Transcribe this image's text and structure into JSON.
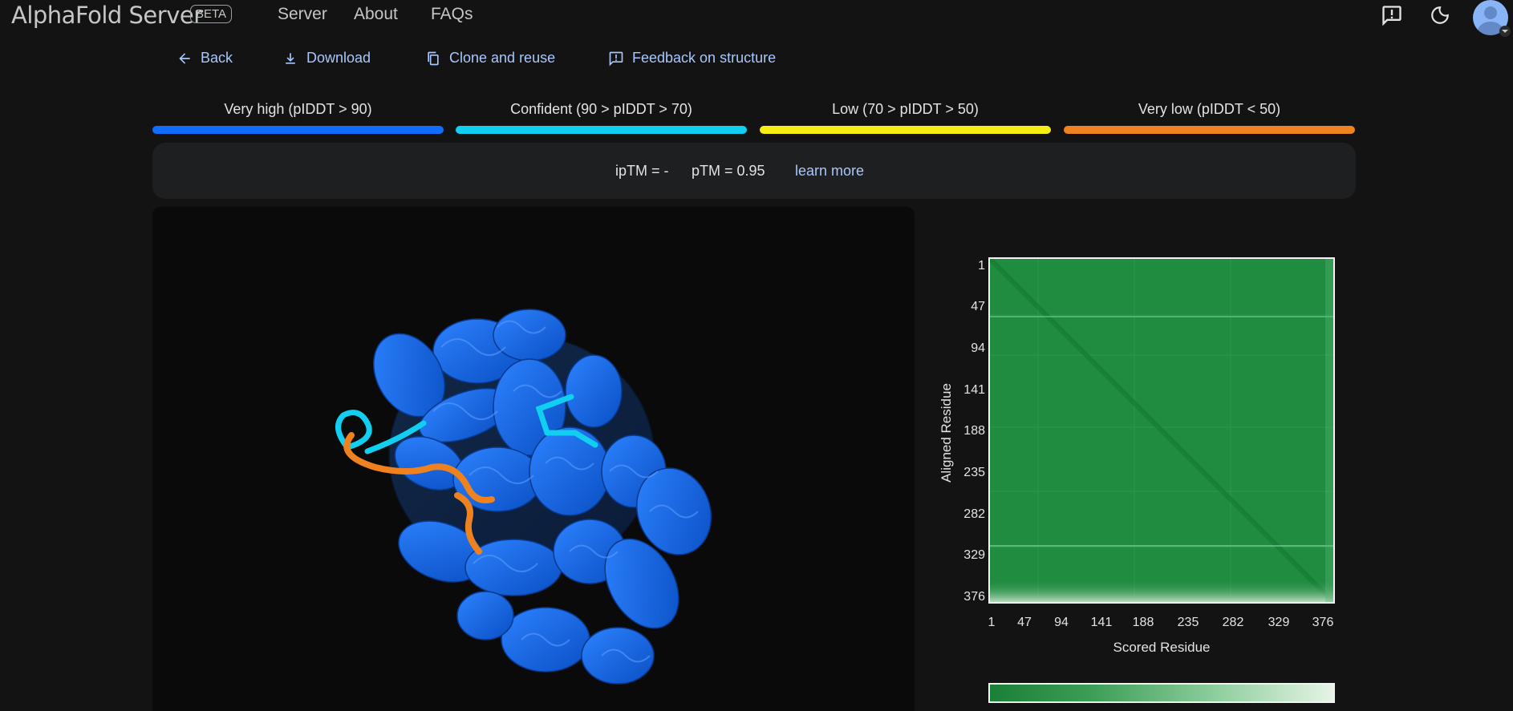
{
  "header": {
    "brand": "AlphaFold Server",
    "badge": "BETA",
    "nav": [
      "Server",
      "About",
      "FAQs"
    ],
    "icons": [
      "feedback-icon",
      "dark-mode-icon",
      "account-avatar"
    ]
  },
  "actions": [
    {
      "label": "Back",
      "icon": "arrow-back-icon"
    },
    {
      "label": "Download",
      "icon": "download-icon"
    },
    {
      "label": "Clone and reuse",
      "icon": "copy-icon"
    },
    {
      "label": "Feedback on structure",
      "icon": "feedback-icon"
    }
  ],
  "plddt_legend": [
    {
      "label": "Very high (pIDDT > 90)",
      "color": "#106dff"
    },
    {
      "label": "Confident (90 > pIDDT > 70)",
      "color": "#10cff1"
    },
    {
      "label": "Low (70 > pIDDT > 50)",
      "color": "#f6ed12"
    },
    {
      "label": "Very low (pIDDT < 50)",
      "color": "#ef821e"
    }
  ],
  "scores": {
    "iptm": "ipTM = -",
    "ptm": "pTM = 0.95",
    "learn_more": "learn more"
  },
  "structure_colors": {
    "very_high": "#106dff",
    "confident": "#10cff1",
    "very_low": "#ef821e"
  },
  "pae_plot": {
    "y_ticks": [
      "1",
      "47",
      "94",
      "141",
      "188",
      "235",
      "282",
      "329",
      "376"
    ],
    "x_ticks": [
      "1",
      "47",
      "94",
      "141",
      "188",
      "235",
      "282",
      "329",
      "376"
    ],
    "ylabel": "Aligned Residue",
    "xlabel": "Scored Residue",
    "colors": {
      "low_error": "#1a7f37",
      "high_error": "#e6f4e6"
    }
  }
}
